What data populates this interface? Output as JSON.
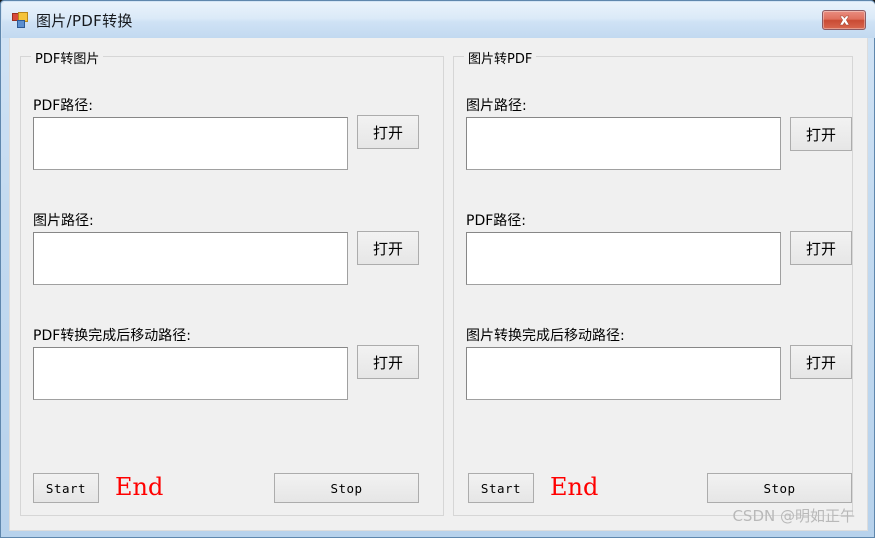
{
  "window": {
    "title": "图片/PDF转换",
    "icon": "winforms-app-icon",
    "close_label": "close-icon",
    "colors": {
      "frame": "#b7d2ec",
      "client_bg": "#f0f0f0",
      "close_red": "#c94b34",
      "accent_red": "#ff0000",
      "groupbox_border": "#d6d6d6",
      "textbox_border": "#878787",
      "watermark": "#b9b9b9"
    }
  },
  "groups": [
    {
      "id": "pdf-to-image",
      "title": "PDF转图片",
      "fields": [
        {
          "label": "PDF路径:",
          "value": "",
          "placeholder": "",
          "button": "打开"
        },
        {
          "label": "图片路径:",
          "value": "",
          "placeholder": "",
          "button": "打开"
        },
        {
          "label": "PDF转换完成后移动路径:",
          "value": "",
          "placeholder": "",
          "button": "打开"
        }
      ],
      "actions": {
        "start": "Start",
        "status": "End",
        "stop": "Stop"
      }
    },
    {
      "id": "image-to-pdf",
      "title": "图片转PDF",
      "fields": [
        {
          "label": "图片路径:",
          "value": "",
          "placeholder": "",
          "button": "打开"
        },
        {
          "label": "PDF路径:",
          "value": "",
          "placeholder": "",
          "button": "打开"
        },
        {
          "label": "图片转换完成后移动路径:",
          "value": "",
          "placeholder": "",
          "button": "打开"
        }
      ],
      "actions": {
        "start": "Start",
        "status": "End",
        "stop": "Stop"
      }
    }
  ],
  "watermark": "CSDN @明如正午"
}
